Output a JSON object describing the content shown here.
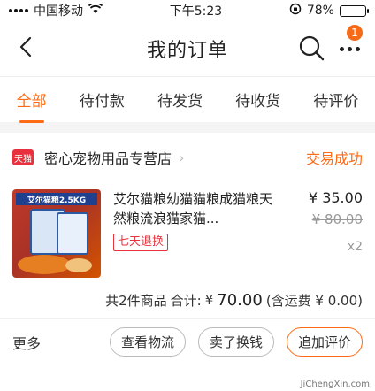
{
  "status_bar": {
    "carrier": "中国移动",
    "time": "下午5:23",
    "battery_text": "78%",
    "battery_level": 0.78
  },
  "nav": {
    "title": "我的订单",
    "badge_count": "1"
  },
  "tabs": [
    {
      "label": "全部",
      "active": true
    },
    {
      "label": "待付款",
      "active": false
    },
    {
      "label": "待发货",
      "active": false
    },
    {
      "label": "待收货",
      "active": false
    },
    {
      "label": "待评价",
      "active": false
    }
  ],
  "order": {
    "shop_badge": "天猫",
    "shop_name": "密心宠物用品专营店",
    "status": "交易成功",
    "item": {
      "thumb_banner": "艾尔猫粮2.5KG",
      "title": "艾尔猫粮幼猫猫粮成猫粮天然粮流浪猫家猫...",
      "tag": "七天退换",
      "price": "¥ 35.00",
      "original_price": "¥ 80.00",
      "qty": "x2"
    },
    "summary": {
      "count_text": "共2件商品",
      "total_label": "合计:",
      "currency": "¥",
      "total": "70.00",
      "shipping": "(含运费 ¥ 0.00)"
    },
    "actions": {
      "more": "更多",
      "logistics": "查看物流",
      "sell": "卖了换钱",
      "review": "追加评价"
    }
  },
  "watermark": "JiChengXin.com",
  "colors": {
    "accent": "#ff6a14",
    "tmall_red": "#e8313d"
  }
}
